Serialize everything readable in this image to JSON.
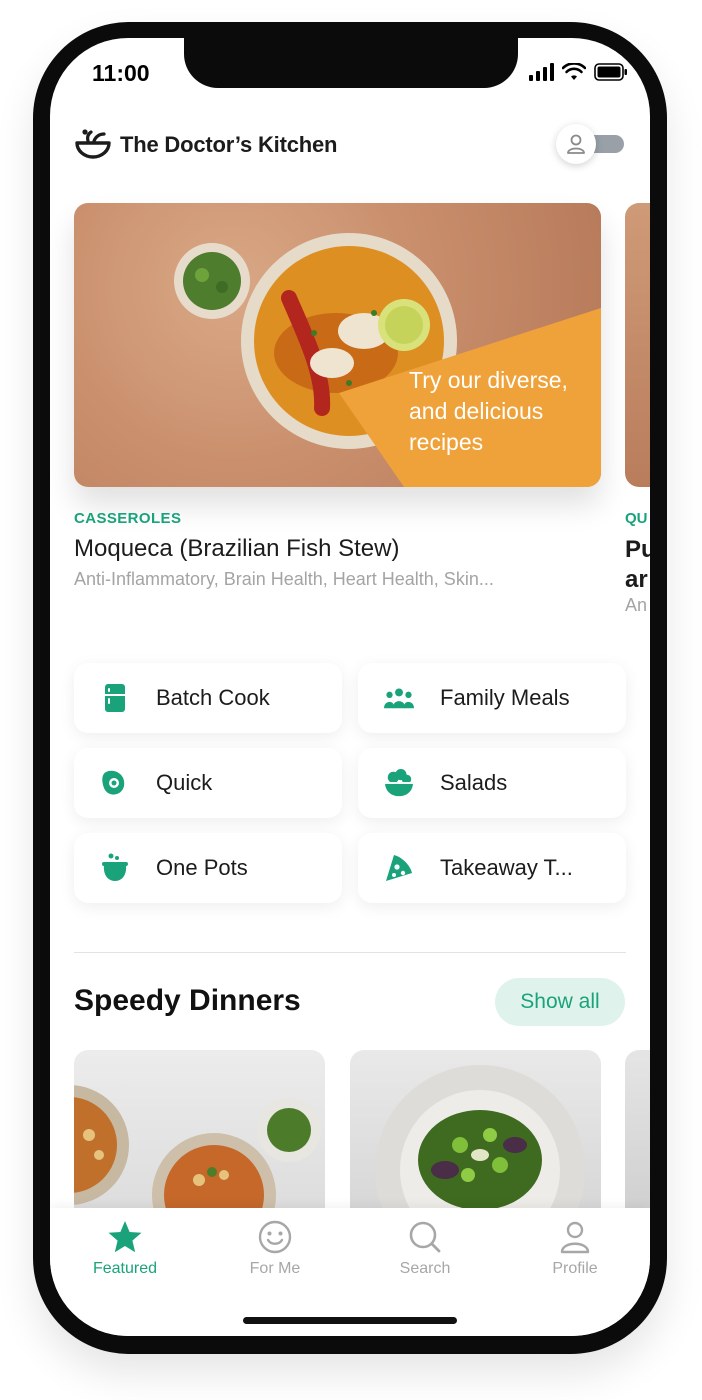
{
  "status_bar": {
    "time": "11:00"
  },
  "header": {
    "brand_name": "The Doctor’s Kitchen"
  },
  "featured": {
    "tagline": "Try our diverse, and delicious recipes",
    "category": "CASSEROLES",
    "title": "Moqueca (Brazilian Fish Stew)",
    "tags": "Anti-Inflammatory, Brain Health, Heart Health, Skin...",
    "peek": {
      "category": "QU",
      "title_line1": "Pu",
      "title_line2": "ar",
      "tags": "An"
    }
  },
  "categories": [
    {
      "label": "Batch Cook",
      "icon": "fridge-icon"
    },
    {
      "label": "Family Meals",
      "icon": "family-icon"
    },
    {
      "label": "Quick",
      "icon": "egg-pan-icon"
    },
    {
      "label": "Salads",
      "icon": "salad-bowl-icon"
    },
    {
      "label": "One Pots",
      "icon": "cauldron-icon"
    },
    {
      "label": "Takeaway T...",
      "icon": "pizza-slice-icon"
    }
  ],
  "section": {
    "title": "Speedy Dinners",
    "show_all_label": "Show all"
  },
  "tabbar": {
    "tabs": [
      {
        "label": "Featured",
        "icon": "star-icon",
        "active": true
      },
      {
        "label": "For Me",
        "icon": "smiley-icon",
        "active": false
      },
      {
        "label": "Search",
        "icon": "search-icon",
        "active": false
      },
      {
        "label": "Profile",
        "icon": "profile-icon",
        "active": false
      }
    ]
  },
  "colors": {
    "accent": "#1aa37a",
    "tagline_panel": "#efa23a",
    "muted_text": "#a4a4a4"
  }
}
